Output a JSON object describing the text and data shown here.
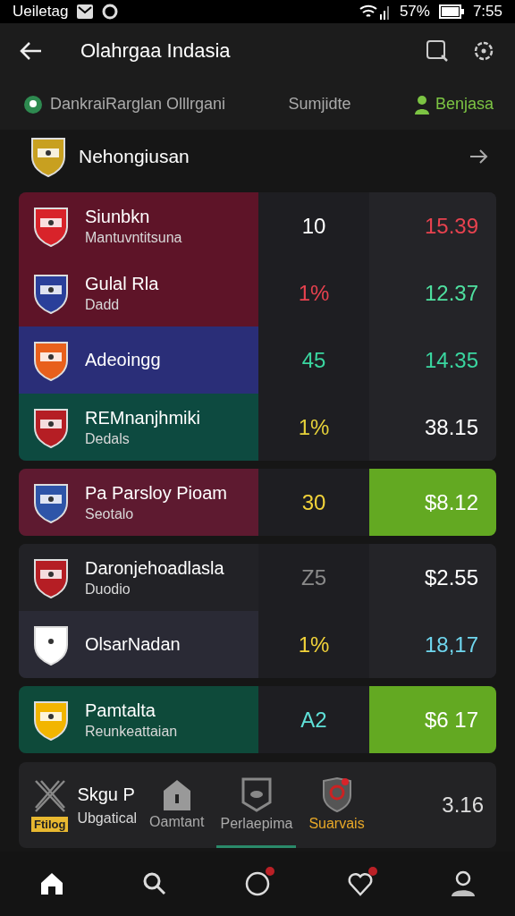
{
  "status_bar": {
    "carrier": "Ueiletag",
    "battery": "57%",
    "time": "7:55"
  },
  "app_bar": {
    "title": "Olahrgaa Indasia"
  },
  "filters": [
    {
      "label": "DankraiRarglan Olllrgani",
      "selected": false
    },
    {
      "label": "Sumjidte",
      "selected": false
    },
    {
      "label": "Benjasa",
      "selected": true
    }
  ],
  "section": {
    "title": "Nehongiusan"
  },
  "groups": [
    [
      {
        "name": "Siunbkn",
        "sub": "Mantuvntitsuna",
        "color": "#5e1428",
        "crest": {
          "color": "#d8232a"
        },
        "value": {
          "text": "10",
          "color": "#ffffff"
        },
        "price": {
          "text": "15.39",
          "color": "#e8424f"
        },
        "price_highlight": false
      },
      {
        "name": "Gulal Rla",
        "sub": "Dadd",
        "color": "#5e1428",
        "crest": {
          "color": "#2a3f9a"
        },
        "value": {
          "text": "1%",
          "color": "#e8424f"
        },
        "price": {
          "text": "12.37",
          "color": "#4fe0a0"
        },
        "price_highlight": false
      },
      {
        "name": "Adeoingg",
        "color": "#2a2e78",
        "crest": {
          "color": "#e8601c"
        },
        "value": {
          "text": "45",
          "color": "#3ad6a0"
        },
        "price": {
          "text": "14.35",
          "color": "#3ad6a0"
        },
        "price_highlight": false
      },
      {
        "name": "REMnanjhmiki",
        "sub": "Dedals",
        "color": "#0d4a40",
        "crest": {
          "color": "#b51e24"
        },
        "value": {
          "text": "1%",
          "color": "#e6d23a"
        },
        "price": {
          "text": "38.15",
          "color": "#ffffff"
        },
        "price_highlight": false
      }
    ],
    [
      {
        "name": "Pa Parsloy Pioam",
        "sub": "Seotalo",
        "color": "#5e1a30",
        "crest": {
          "color": "#2e55a8"
        },
        "value": {
          "text": "30",
          "color": "#f2d33a"
        },
        "price": {
          "text": "$8.12",
          "color": "#ffffff"
        },
        "price_highlight": true
      }
    ],
    [
      {
        "name": "Daronjehoadlasla",
        "sub": "Duodio",
        "color": "#222226",
        "crest": {
          "color": "#b51e24"
        },
        "value": {
          "text": "Z5",
          "color": "#8a8a8a"
        },
        "price": {
          "text": "$2.55",
          "color": "#ffffff"
        },
        "price_highlight": false
      },
      {
        "name": "OlsarNadan",
        "color": "#2a2a35",
        "crest": {
          "color": "#ffffff"
        },
        "value": {
          "text": "1%",
          "color": "#f2d33a"
        },
        "price": {
          "text": "18,17",
          "color": "#6fd6ee"
        },
        "price_highlight": false
      }
    ],
    [
      {
        "name": "Pamtalta",
        "sub": "Reunkeattaian",
        "color": "#0e4a3a",
        "crest": {
          "color": "#f2b500"
        },
        "value": {
          "text": "A2",
          "color": "#5fe0d8"
        },
        "price": {
          "text": "$6 17",
          "color": "#ffffff"
        },
        "price_highlight": true
      }
    ]
  ],
  "bottom_card": {
    "name": "Skgu P",
    "sub": "Ubgatical",
    "badge": "Ftilog",
    "tabs": [
      {
        "label": "Oamtant",
        "selected": false
      },
      {
        "label": "Perlaepima",
        "selected": true
      },
      {
        "label": "Suarvais",
        "selected": false
      }
    ],
    "value": "3.16"
  },
  "nav": [
    {
      "selected": true,
      "dot": false
    },
    {
      "selected": false,
      "dot": false
    },
    {
      "selected": false,
      "dot": true
    },
    {
      "selected": false,
      "dot": true
    },
    {
      "selected": false,
      "dot": false
    }
  ]
}
